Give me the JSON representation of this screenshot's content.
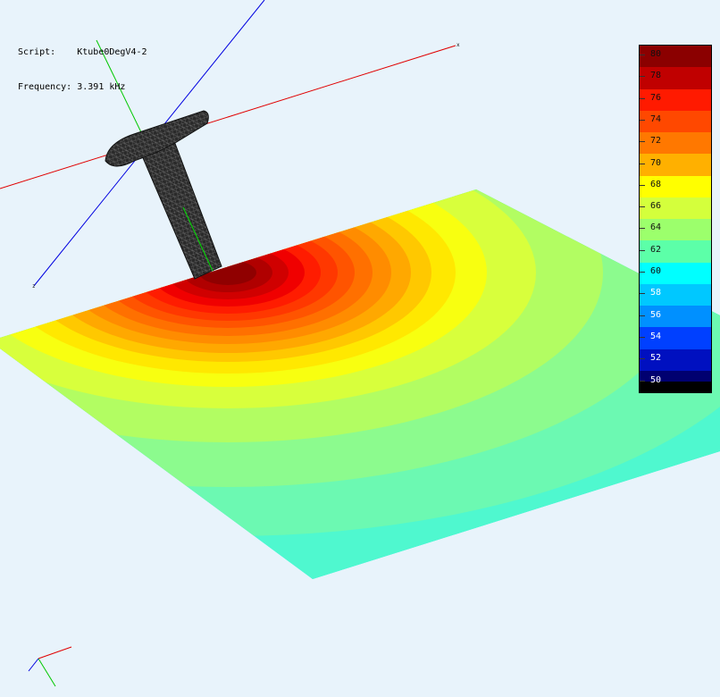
{
  "info": {
    "script_label": "Script:",
    "script_value": "Ktube0DegV4-2",
    "frequency_label": "Frequency:",
    "frequency_value": "3.391 kHz"
  },
  "axes": {
    "x_label": "x",
    "z_label": "z"
  },
  "colorbar": {
    "labels": [
      "80",
      "78",
      "76",
      "74",
      "72",
      "70",
      "68",
      "66",
      "64",
      "62",
      "60",
      "58",
      "56",
      "54",
      "52",
      "50"
    ],
    "min": 50,
    "max": 80,
    "colors": {
      "80": "#8b0000",
      "78": "#c00000",
      "76": "#ff1a00",
      "74": "#ff4800",
      "72": "#ff7800",
      "70": "#ffb000",
      "68": "#ffff00",
      "66": "#d4ff3c",
      "64": "#9cff6c",
      "62": "#5cffa8",
      "60": "#00ffff",
      "58": "#00c8ff",
      "56": "#0090ff",
      "54": "#0040ff",
      "52": "#0010c0",
      "50": "#000070"
    }
  }
}
